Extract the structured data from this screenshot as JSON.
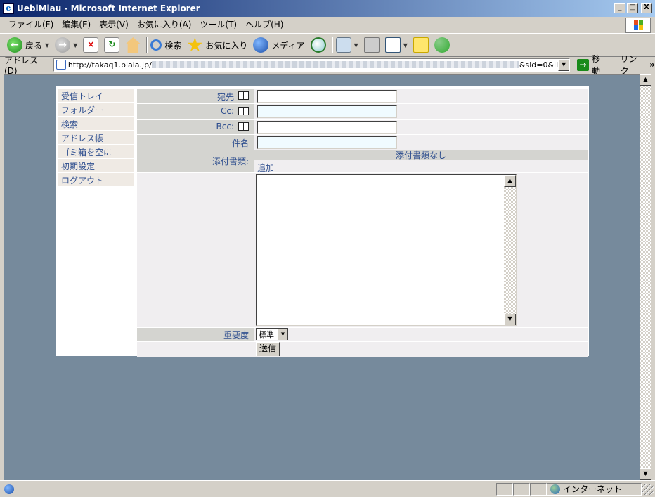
{
  "window": {
    "title": "UebiMiau - Microsoft Internet Explorer",
    "controls": {
      "minimize": "_",
      "maximize": "□",
      "close": "X"
    }
  },
  "menu": [
    "ファイル(F)",
    "編集(E)",
    "表示(V)",
    "お気に入り(A)",
    "ツール(T)",
    "ヘルプ(H)"
  ],
  "toolbar": {
    "back": "戻る",
    "search": "検索",
    "favorites": "お気に入り",
    "media": "メディア"
  },
  "address": {
    "label": "アドレス(D)",
    "url_visible": "http://takaq1.plala.jp/",
    "url_tail": "&sid=0&li",
    "go": "移動",
    "links": "リンク",
    "chevron": "»"
  },
  "nav": {
    "items": [
      "受信トレイ",
      "フォルダー",
      "検索",
      "アドレス帳",
      "ゴミ箱を空に",
      "初期設定",
      "ログアウト"
    ]
  },
  "compose": {
    "to_label": "宛先",
    "cc_label": "Cc:",
    "bcc_label": "Bcc:",
    "subject_label": "件名",
    "to_value": "",
    "cc_value": "",
    "bcc_value": "",
    "subject_value": "",
    "attachments_label": "添付書類:",
    "no_attachments": "添付書類なし",
    "add_attachment": "追加",
    "body_value": "",
    "priority_label": "重要度",
    "priority_selected": "標準",
    "send_button": "送信"
  },
  "status": {
    "zone": "インターネット"
  }
}
